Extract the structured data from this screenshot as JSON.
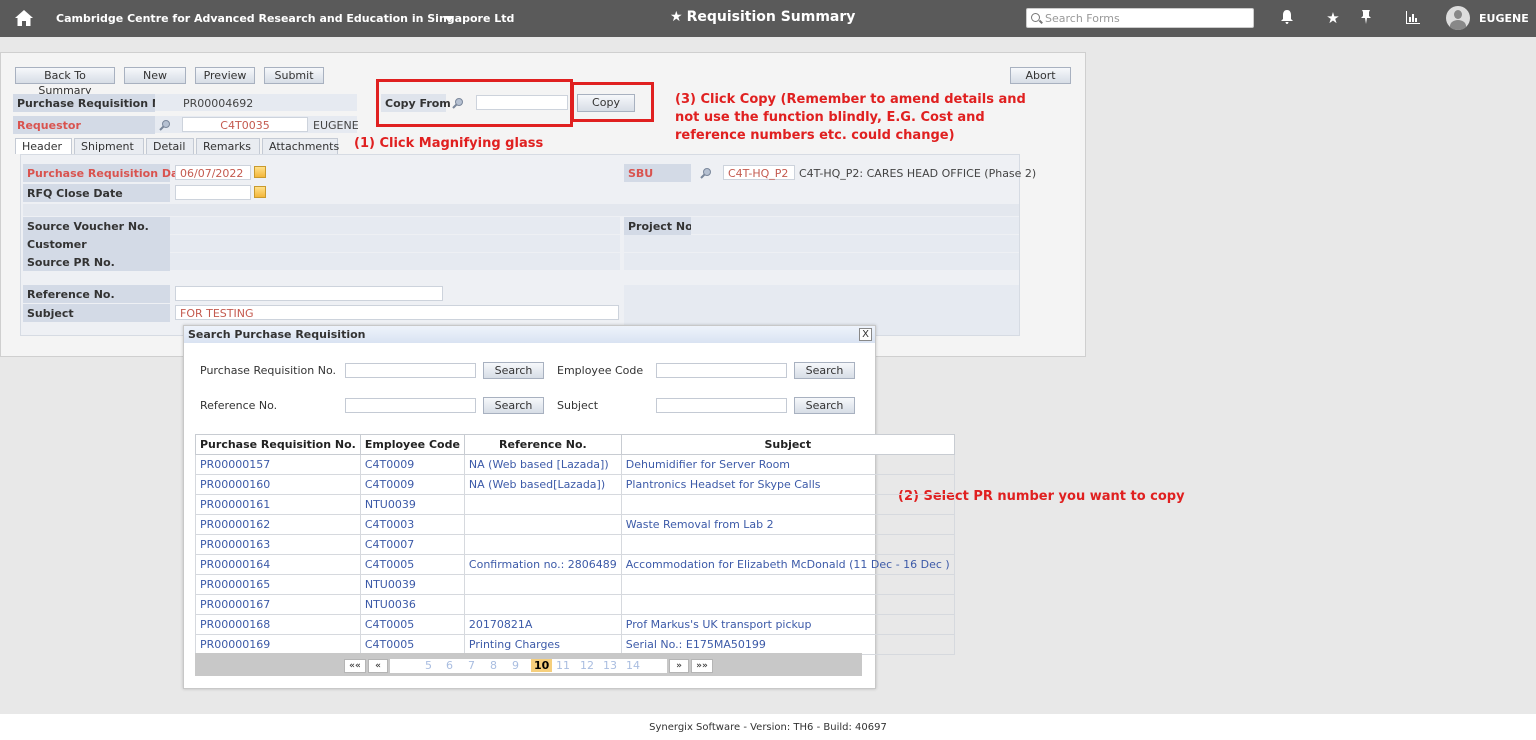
{
  "topbar": {
    "org": "Cambridge Centre for Advanced Research and Education in Singapore Ltd",
    "title": "Requisition Summary",
    "search_placeholder": "Search Forms",
    "user": "EUGENE"
  },
  "toolbar": {
    "back": "Back To Summary",
    "new": "New",
    "preview": "Preview",
    "submit": "Submit",
    "abort": "Abort"
  },
  "header": {
    "pr_no_label": "Purchase Requisition No.",
    "pr_no_value": "PR00004692",
    "requestor_label": "Requestor",
    "requestor_code": "C4T0035",
    "requestor_name": "EUGENE",
    "copy_from_label": "Copy From",
    "copy_button": "Copy"
  },
  "tabs": [
    "Header",
    "Shipment",
    "Detail",
    "Remarks",
    "Attachments"
  ],
  "form": {
    "pr_date_label": "Purchase Requisition Date",
    "pr_date_value": "06/07/2022",
    "rfq_label": "RFQ Close Date",
    "sbu_label": "SBU",
    "sbu_code": "C4T-HQ_P2",
    "sbu_name": "C4T-HQ_P2: CARES HEAD OFFICE (Phase 2)",
    "source_voucher_label": "Source Voucher No.",
    "project_label": "Project No.",
    "customer_label": "Customer",
    "source_pr_label": "Source PR No.",
    "reference_label": "Reference No.",
    "subject_label": "Subject",
    "subject_value": "FOR TESTING"
  },
  "annotations": {
    "a1": "(1) Click Magnifying glass",
    "a2": "(2) Select PR number you want to copy",
    "a3_line1": "(3) Click Copy (Remember to amend details and",
    "a3_line2": "not use the function blindly, E.G. Cost and",
    "a3_line3": "reference numbers etc. could change)"
  },
  "dialog": {
    "title": "Search Purchase Requisition",
    "close": "X",
    "pr_no_label": "Purchase Requisition No.",
    "employee_label": "Employee Code",
    "reference_label": "Reference No.",
    "subject_label": "Subject",
    "search_button": "Search",
    "columns": [
      "Purchase Requisition No.",
      "Employee Code",
      "Reference No.",
      "Subject"
    ],
    "rows": [
      [
        "PR00000157",
        "C4T0009",
        "NA (Web based [Lazada])",
        "Dehumidifier for Server Room"
      ],
      [
        "PR00000160",
        "C4T0009",
        "NA (Web based[Lazada])",
        "Plantronics Headset for Skype Calls"
      ],
      [
        "PR00000161",
        "NTU0039",
        "",
        ""
      ],
      [
        "PR00000162",
        "C4T0003",
        "",
        "Waste Removal from Lab 2"
      ],
      [
        "PR00000163",
        "C4T0007",
        "",
        ""
      ],
      [
        "PR00000164",
        "C4T0005",
        "Confirmation no.: 2806489",
        "Accommodation for Elizabeth McDonald (11 Dec - 16 Dec )"
      ],
      [
        "PR00000165",
        "NTU0039",
        "",
        ""
      ],
      [
        "PR00000167",
        "NTU0036",
        "",
        ""
      ],
      [
        "PR00000168",
        "C4T0005",
        "20170821A",
        "Prof Markus's UK transport pickup"
      ],
      [
        "PR00000169",
        "C4T0005",
        "Printing Charges",
        "Serial No.: E175MA50199"
      ]
    ],
    "pager": {
      "first": "««",
      "prev": "«",
      "next": "»",
      "last": "»»",
      "pages": [
        "5",
        "6",
        "7",
        "8",
        "9",
        "10",
        "11",
        "12",
        "13",
        "14"
      ],
      "current": "10"
    }
  },
  "footer": "Synergix Software - Version: TH6 - Build: 40697"
}
